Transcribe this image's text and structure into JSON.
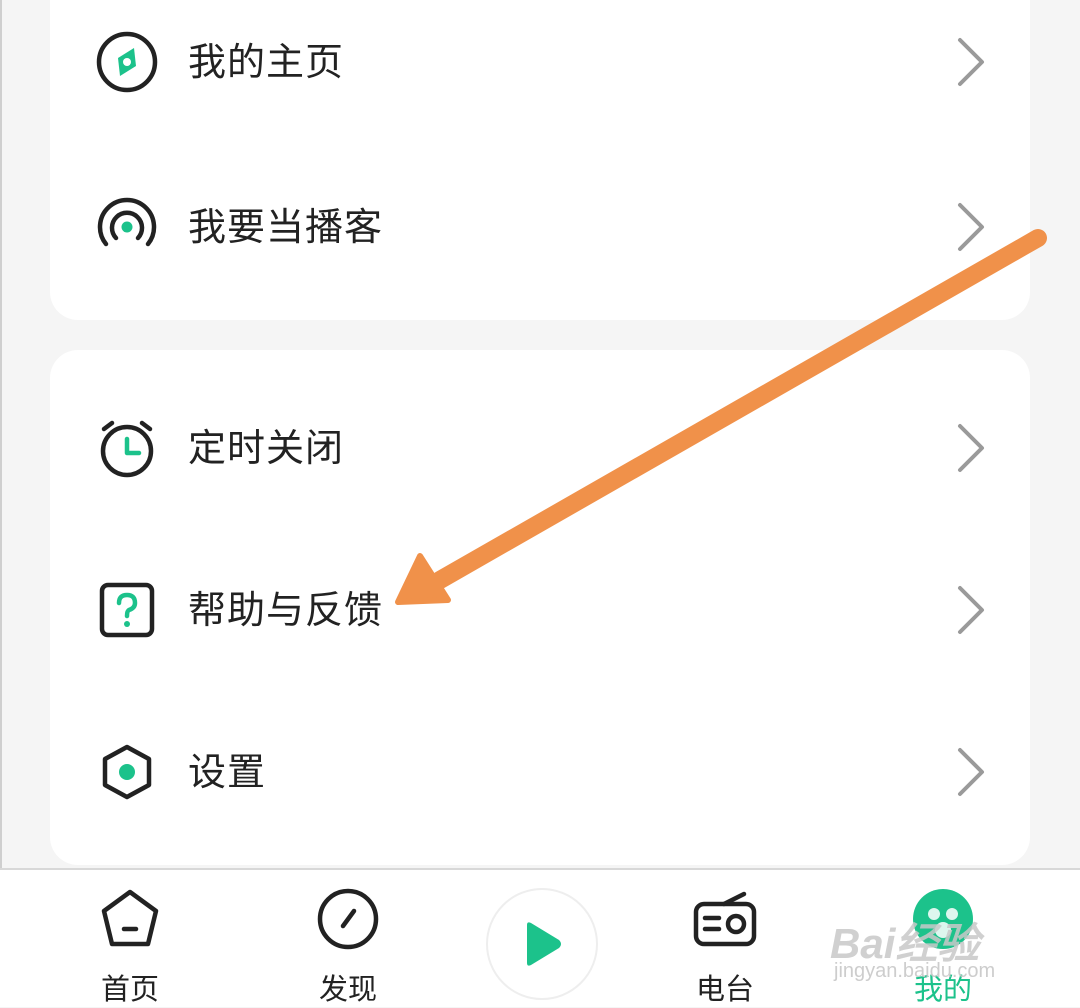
{
  "menu_group_1": [
    {
      "label": "我的主页",
      "icon": "compass-icon"
    },
    {
      "label": "我要当播客",
      "icon": "podcast-icon"
    }
  ],
  "menu_group_2": [
    {
      "label": "定时关闭",
      "icon": "alarm-clock-icon"
    },
    {
      "label": "帮助与反馈",
      "icon": "help-icon"
    },
    {
      "label": "设置",
      "icon": "settings-icon"
    }
  ],
  "tabbar": {
    "home_label": "首页",
    "discover_label": "发现",
    "radio_label": "电台",
    "mine_label": "我的"
  },
  "watermark": {
    "brand": "Bai经验",
    "url": "jingyan.baidu.com"
  },
  "colors": {
    "accent": "#1cc28b",
    "annotation_arrow": "#f0914a"
  }
}
